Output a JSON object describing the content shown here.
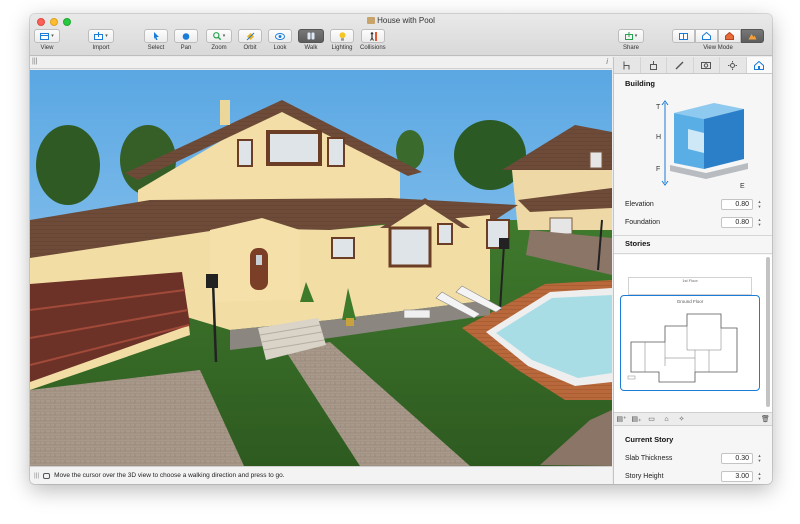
{
  "window": {
    "title": "House with Pool"
  },
  "toolbar": {
    "view": "View",
    "import": "Import",
    "select": "Select",
    "pan": "Pan",
    "zoom": "Zoom",
    "orbit": "Orbit",
    "look": "Look",
    "walk": "Walk",
    "lighting": "Lighting",
    "collisions": "Collisions",
    "share": "Share",
    "view_mode": "View Mode"
  },
  "status": {
    "message": "Move the cursor over the 3D view to choose a walking direction and press to go."
  },
  "panel": {
    "building": {
      "title": "Building",
      "diagram_letters": {
        "t": "T",
        "h": "H",
        "f": "F",
        "e": "E"
      },
      "elevation_label": "Elevation",
      "elevation_value": "0.80",
      "foundation_label": "Foundation",
      "foundation_value": "0.80"
    },
    "stories": {
      "title": "Stories",
      "first_floor": "1st Floor",
      "ground_floor": "Ground Floor"
    },
    "current_story": {
      "title": "Current Story",
      "slab_label": "Slab Thickness",
      "slab_value": "0.30",
      "height_label": "Story Height",
      "height_value": "3.00"
    }
  },
  "colors": {
    "accent": "#1a7bd8",
    "walk_active": "#5d5d5d",
    "sky": "#6fb6e6",
    "grass": "#3b6b2a",
    "wall": "#f1dca4",
    "roof": "#6a4836",
    "pool": "#a9dde6"
  }
}
